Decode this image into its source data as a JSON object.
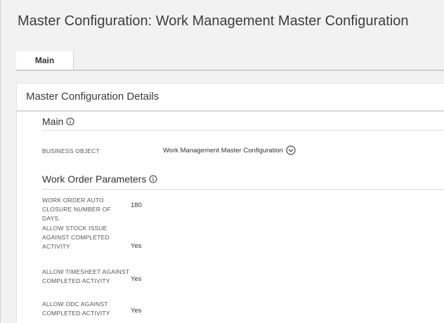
{
  "page": {
    "title": "Master Configuration: Work Management Master Configuration"
  },
  "tabs": [
    {
      "label": "Main"
    }
  ],
  "card": {
    "title": "Master Configuration Details"
  },
  "sections": {
    "main": {
      "title": "Main",
      "icon": "info-icon",
      "fields": [
        {
          "label": "BUSINESS OBJECT",
          "value": "Work Management Master Configuration",
          "icon": "chevron-down-circle-icon"
        }
      ]
    },
    "work_order": {
      "title": "Work Order Parameters",
      "icon": "info-icon",
      "fields": [
        {
          "label": "WORK ORDER AUTO CLOSURE NUMBER OF DAYS",
          "value": "180"
        },
        {
          "label": "ALLOW STOCK ISSUE AGAINST COMPLETED ACTIVITY",
          "value": "Yes"
        },
        {
          "label": "ALLOW TIMESHEET AGAINST COMPLETED ACTIVITY",
          "value": "Yes"
        },
        {
          "label": "ALLOW ODC AGAINST COMPLETED ACTIVITY",
          "value": "Yes"
        }
      ]
    }
  }
}
